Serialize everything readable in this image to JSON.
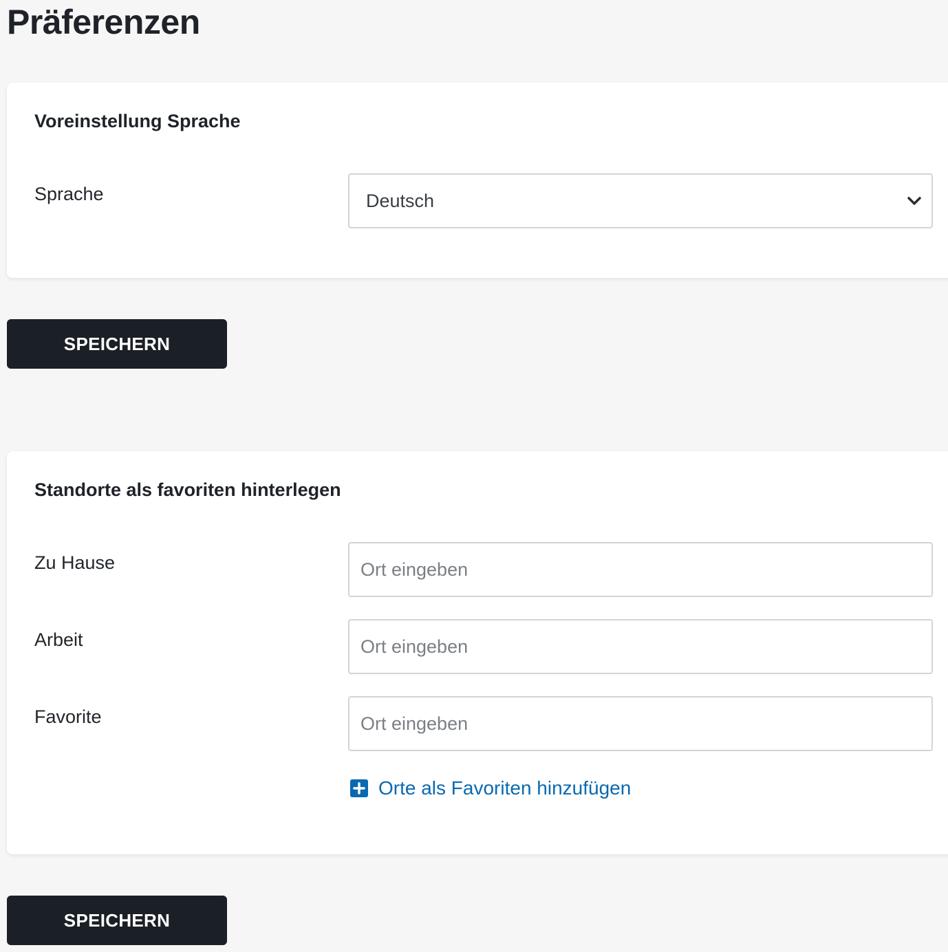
{
  "page": {
    "title": "Präferenzen"
  },
  "language_section": {
    "title": "Voreinstellung Sprache",
    "language_label": "Sprache",
    "language_value": "Deutsch",
    "save_label": "SPEICHERN"
  },
  "favorites_section": {
    "title": "Standorte als favoriten hinterlegen",
    "fields": [
      {
        "label": "Zu Hause",
        "placeholder": "Ort eingeben"
      },
      {
        "label": "Arbeit",
        "placeholder": "Ort eingeben"
      },
      {
        "label": "Favorite",
        "placeholder": "Ort eingeben"
      }
    ],
    "add_label": "Orte als Favoriten hinzufügen",
    "save_label": "SPEICHERN"
  },
  "colors": {
    "background": "#f6f6f6",
    "card": "#ffffff",
    "button": "#1b1f26",
    "link": "#0a69b1"
  },
  "icons": {
    "select_chevron": "chevron-down-icon",
    "add": "plus-square-icon"
  }
}
